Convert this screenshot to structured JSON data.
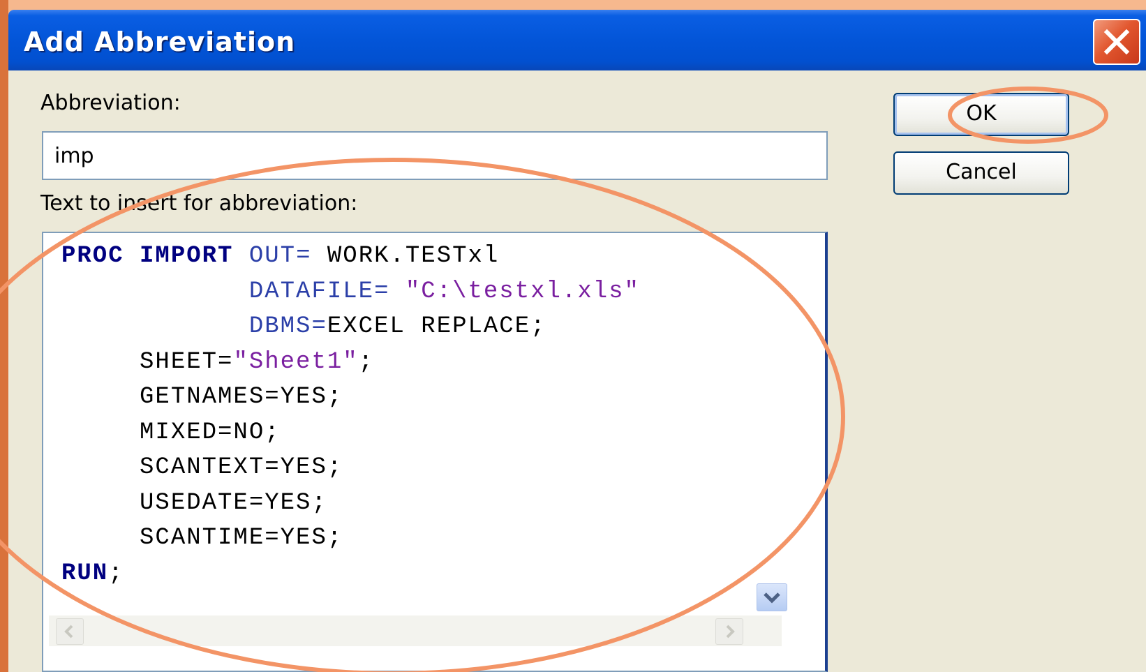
{
  "dialog": {
    "title": "Add Abbreviation",
    "abbreviation_label": "Abbreviation:",
    "abbreviation_value": "imp",
    "text_label": "Text to insert for abbreviation:",
    "buttons": {
      "ok": "OK",
      "cancel": "Cancel"
    },
    "code_lines": [
      {
        "segments": [
          {
            "t": "PROC",
            "s": "kw"
          },
          {
            "t": " "
          },
          {
            "t": "IMPORT",
            "s": "kw"
          },
          {
            "t": " "
          },
          {
            "t": "OUT=",
            "s": "opt"
          },
          {
            "t": " WORK.TESTxl"
          }
        ]
      },
      {
        "segments": [
          {
            "t": "            "
          },
          {
            "t": "DATAFILE=",
            "s": "opt"
          },
          {
            "t": " "
          },
          {
            "t": "\"C:\\testxl.xls\"",
            "s": "str"
          }
        ]
      },
      {
        "segments": [
          {
            "t": "            "
          },
          {
            "t": "DBMS=",
            "s": "opt"
          },
          {
            "t": "EXCEL REPLACE;"
          }
        ]
      },
      {
        "segments": [
          {
            "t": "     SHEET="
          },
          {
            "t": "\"Sheet1\"",
            "s": "str"
          },
          {
            "t": ";"
          }
        ]
      },
      {
        "segments": [
          {
            "t": "     GETNAMES=YES;"
          }
        ]
      },
      {
        "segments": [
          {
            "t": "     MIXED=NO;"
          }
        ]
      },
      {
        "segments": [
          {
            "t": "     SCANTEXT=YES;"
          }
        ]
      },
      {
        "segments": [
          {
            "t": "     USEDATE=YES;"
          }
        ]
      },
      {
        "segments": [
          {
            "t": "     SCANTIME=YES;"
          }
        ]
      },
      {
        "segments": [
          {
            "t": "RUN",
            "s": "kw"
          },
          {
            "t": ";"
          }
        ]
      }
    ]
  },
  "colors": {
    "titlebar": "#0355d8",
    "dialog_bg": "#ece9d8",
    "highlight_circle": "#f39466",
    "keyword": "#000080",
    "string": "#7a1fa0"
  }
}
